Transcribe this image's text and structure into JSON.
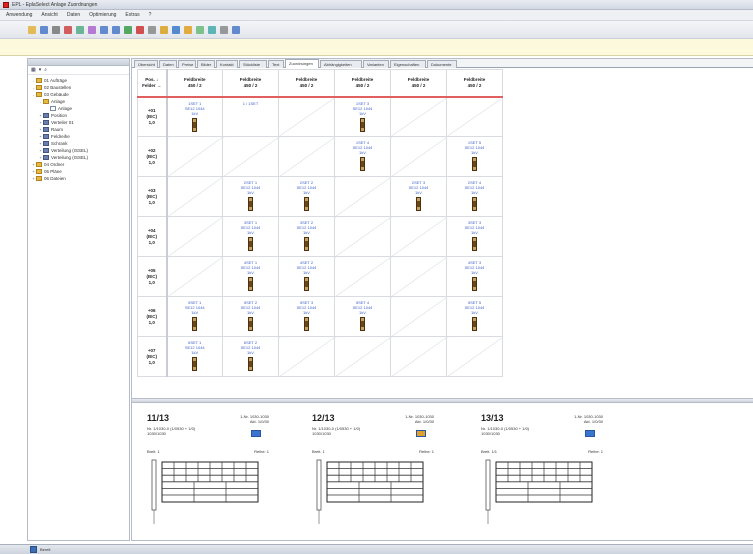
{
  "window": {
    "title": "EPL - EplaSelect Anlage Zuordnungen"
  },
  "menu": [
    "Anwendung",
    "Ansicht",
    "Daten",
    "Optimierung",
    "Extras",
    "?"
  ],
  "toolbar_icons": [
    "open-icon",
    "save-icon",
    "print-icon",
    "cut-icon",
    "copy-icon",
    "paste-icon",
    "undo-icon",
    "redo-icon",
    "add-icon",
    "delete-icon",
    "move-icon",
    "filter-icon",
    "chart-icon",
    "warning-icon",
    "edit-icon",
    "refresh-icon",
    "settings-icon",
    "help-icon"
  ],
  "tree": {
    "items": [
      {
        "depth": 0,
        "expander": "-",
        "icon": "folder",
        "label": "01 Aufträge"
      },
      {
        "depth": 0,
        "expander": "-",
        "icon": "folder",
        "label": "02 Baustellen"
      },
      {
        "depth": 0,
        "expander": "-",
        "icon": "folder",
        "label": "03 Gebäude"
      },
      {
        "depth": 1,
        "expander": "-",
        "icon": "folder",
        "label": "Anlage"
      },
      {
        "depth": 2,
        "expander": "",
        "icon": "doc",
        "label": "Anlage"
      },
      {
        "depth": 1,
        "expander": "+",
        "icon": "comp",
        "label": "Position"
      },
      {
        "depth": 1,
        "expander": "+",
        "icon": "comp",
        "label": "Verteiler 01"
      },
      {
        "depth": 1,
        "expander": "+",
        "icon": "comp",
        "label": "Raum"
      },
      {
        "depth": 1,
        "expander": "+",
        "icon": "comp",
        "label": "Feldreihe"
      },
      {
        "depth": 1,
        "expander": "+",
        "icon": "comp",
        "label": "Schrank"
      },
      {
        "depth": 1,
        "expander": "+",
        "icon": "comp",
        "label": "Verteilung (ISSEL)"
      },
      {
        "depth": 1,
        "expander": "+",
        "icon": "comp",
        "label": "Verteilung (ISSEL)"
      },
      {
        "depth": 0,
        "expander": "+",
        "icon": "folder",
        "label": "04 Ordner"
      },
      {
        "depth": 0,
        "expander": "+",
        "icon": "folder",
        "label": "05 Pläne"
      },
      {
        "depth": 0,
        "expander": "+",
        "icon": "folder",
        "label": "06 Dateien"
      }
    ]
  },
  "tabs": [
    {
      "label": "Übersicht",
      "width": 24,
      "active": false
    },
    {
      "label": "Daten",
      "width": 18,
      "active": false
    },
    {
      "label": "Preise",
      "width": 18,
      "active": false
    },
    {
      "label": "Bilder",
      "width": 18,
      "active": false
    },
    {
      "label": "Kontakt",
      "width": 22,
      "active": false
    },
    {
      "label": "Stückliste",
      "width": 28,
      "active": false
    },
    {
      "label": "Text",
      "width": 16,
      "active": false
    },
    {
      "label": "Zuordnungen",
      "width": 34,
      "active": true
    },
    {
      "label": "Abhängigkeiten",
      "width": 42,
      "active": false
    },
    {
      "label": "Varianten",
      "width": 26,
      "active": false
    },
    {
      "label": "Eigenschaften",
      "width": 36,
      "active": false
    },
    {
      "label": "Dokumente",
      "width": 30,
      "active": false
    }
  ],
  "grid": {
    "corner": [
      "Pos. ↓",
      "Felder →"
    ],
    "columns": [
      [
        "Feldbreite",
        "450 / 2"
      ],
      [
        "Feldbreite",
        "450 / 2"
      ],
      [
        "Feldbreite",
        "450 / 2"
      ],
      [
        "Feldbreite",
        "450 / 2"
      ],
      [
        "Feldbreite",
        "450 / 2"
      ],
      [
        "Feldbreite",
        "450 / 2"
      ]
    ],
    "rows": [
      {
        "head": [
          "+01",
          "(IEC)",
          "1,0"
        ],
        "cells": [
          {
            "text": [
              "1SET 1",
              "SE12 1044",
              "1kV"
            ],
            "fuse": true
          },
          {
            "text": [
              "1 / 1SET"
            ],
            "fuse": false
          },
          null,
          {
            "text": [
              "1SET 3",
              "SE12 1044",
              "1kV"
            ],
            "fuse": true
          },
          null,
          null
        ]
      },
      {
        "head": [
          "+02",
          "(IEC)",
          "1,0"
        ],
        "cells": [
          null,
          null,
          null,
          {
            "text": [
              "1SET 4",
              "SE12 1044",
              "1kV"
            ],
            "fuse": true
          },
          null,
          {
            "text": [
              "1SET 5",
              "SE12 1044",
              "1kV"
            ],
            "fuse": true
          }
        ]
      },
      {
        "head": [
          "+03",
          "(IEC)",
          "1,0"
        ],
        "cells": [
          null,
          {
            "text": [
              "2SET 1",
              "SE12 1044",
              "1kV"
            ],
            "fuse": true
          },
          {
            "text": [
              "2SET 2",
              "SE12 1044",
              "1kV"
            ],
            "fuse": true
          },
          null,
          {
            "text": [
              "2SET 3",
              "SE12 1044",
              "1kV"
            ],
            "fuse": true
          },
          {
            "text": [
              "2SET 4",
              "SE12 1044",
              "1kV"
            ],
            "fuse": true
          }
        ]
      },
      {
        "head": [
          "+04",
          "(IEC)",
          "1,0"
        ],
        "cells": [
          null,
          {
            "text": [
              "3SET 1",
              "SE12 1044",
              "1kV"
            ],
            "fuse": true
          },
          {
            "text": [
              "3SET 2",
              "SE12 1044",
              "1kV"
            ],
            "fuse": true
          },
          null,
          null,
          {
            "text": [
              "3SET 3",
              "SE12 1044",
              "1kV"
            ],
            "fuse": true
          }
        ]
      },
      {
        "head": [
          "+05",
          "(IEC)",
          "1,0"
        ],
        "cells": [
          null,
          {
            "text": [
              "4SET 1",
              "SE12 1044",
              "1kV"
            ],
            "fuse": true
          },
          {
            "text": [
              "4SET 2",
              "SE12 1044",
              "1kV"
            ],
            "fuse": true
          },
          null,
          null,
          {
            "text": [
              "4SET 3",
              "SE12 1044",
              "1kV"
            ],
            "fuse": true
          }
        ]
      },
      {
        "head": [
          "+06",
          "(IEC)",
          "1,0"
        ],
        "cells": [
          {
            "text": [
              "5SET 1",
              "SE12 1044",
              "1kV"
            ],
            "fuse": true
          },
          {
            "text": [
              "5SET 2",
              "SE12 1044",
              "1kV"
            ],
            "fuse": true
          },
          {
            "text": [
              "5SET 3",
              "SE12 1044",
              "1kV"
            ],
            "fuse": true
          },
          {
            "text": [
              "5SET 4",
              "SE12 1044",
              "1kV"
            ],
            "fuse": true
          },
          null,
          {
            "text": [
              "5SET 5",
              "SE12 1044",
              "1kV"
            ],
            "fuse": true
          }
        ]
      },
      {
        "head": [
          "+07",
          "(IEC)",
          "1,0"
        ],
        "cells": [
          {
            "text": [
              "6SET 1",
              "SE12 1044",
              "1kV"
            ],
            "fuse": true
          },
          {
            "text": [
              "6SET 2",
              "SE12 1044",
              "1kV"
            ],
            "fuse": true
          },
          null,
          null,
          null,
          null
        ]
      }
    ]
  },
  "cards": [
    {
      "number": "11/13",
      "pos": [
        "1-Nr. 1030-1030",
        "Akt. 1/0/30"
      ],
      "ref": [
        "Nr. 1/1030-0 (1/0530 + 1/0)",
        "1030/1030"
      ],
      "swatch": "#3a74d1",
      "meta_a": "Breit. 1",
      "meta_b": "Reihe: 1"
    },
    {
      "number": "12/13",
      "pos": [
        "1-Nr. 1030-1030",
        "Akt. 1/0/30"
      ],
      "ref": [
        "Nr. 1/1030-0 (1/0530 + 1/0)",
        "1030/1030"
      ],
      "swatch": "#e0a030",
      "meta_a": "Breit. 1",
      "meta_b": "Reihe: 1"
    },
    {
      "number": "13/13",
      "pos": [
        "1-Nr. 1030-1030",
        "Akt. 1/0/30"
      ],
      "ref": [
        "Nr. 1/1030-0 (1/0530 + 1/0)",
        "1030/1030"
      ],
      "swatch": "#3a74d1",
      "meta_a": "Breit. 1/1",
      "meta_b": "Reihe: 1"
    }
  ],
  "status": {
    "text": "Bereit"
  }
}
